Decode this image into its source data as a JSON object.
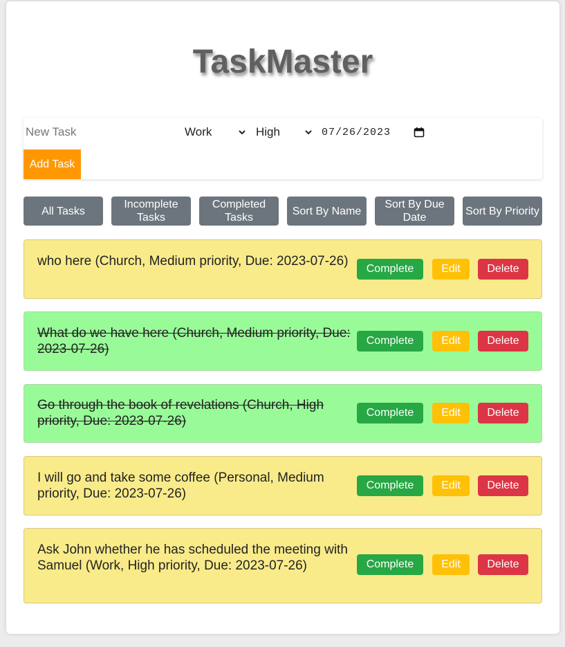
{
  "app": {
    "title": "TaskMaster"
  },
  "form": {
    "task_placeholder": "New Task",
    "task_value": "",
    "category_selected": "Work",
    "priority_selected": "High",
    "date_value": "07/26/2023",
    "add_label": "Add Task",
    "add_color": "#ff9800"
  },
  "filters": {
    "all": "All Tasks",
    "incomplete": "Incomplete Tasks",
    "completed": "Completed Tasks",
    "sort_name": "Sort By Name",
    "sort_due": "Sort By Due Date",
    "sort_priority": "Sort By Priority",
    "color": "#6c757d"
  },
  "actions": {
    "complete": "Complete",
    "edit": "Edit",
    "delete": "Delete"
  },
  "tasks": [
    {
      "text": "who here (Church, Medium priority, Due: 2023-07-26)",
      "completed": false
    },
    {
      "text": "What do we have here (Church, Medium priority, Due: 2023-07-26)",
      "completed": true
    },
    {
      "text": "Go through the book of revelations (Church, High priority, Due: 2023-07-26)",
      "completed": true
    },
    {
      "text": "I will go and take some coffee (Personal, Medium priority, Due: 2023-07-26)",
      "completed": false
    },
    {
      "text": "Ask John whether he has scheduled the meeting with Samuel (Work, High priority, Due: 2023-07-26)",
      "completed": false
    }
  ],
  "colors": {
    "incomplete_bg": "#f9eb8a",
    "completed_bg": "#98fb98",
    "complete_btn": "#28a745",
    "edit_btn": "#ffc107",
    "delete_btn": "#dc3545"
  }
}
